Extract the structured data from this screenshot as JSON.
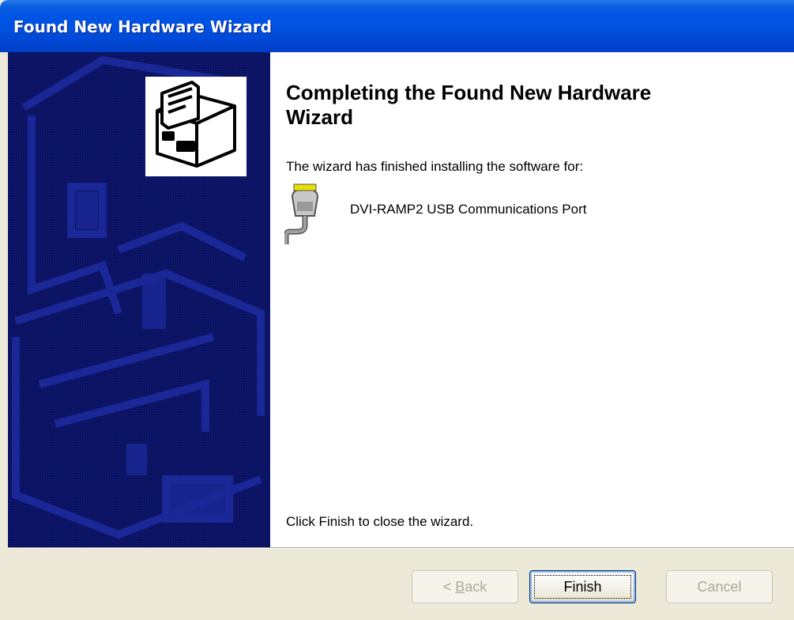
{
  "window": {
    "title": "Found New Hardware Wizard"
  },
  "wizard": {
    "heading": "Completing the Found New Hardware Wizard",
    "intro": "The wizard has finished installing the software for:",
    "device_name": "DVI-RAMP2 USB Communications Port",
    "device_icon": "serial-port-icon",
    "wizard_icon": "hardware-wizard-icon",
    "footer": "Click Finish to close the wizard."
  },
  "buttons": {
    "back": {
      "label_pre": "< ",
      "label_accel": "B",
      "label_post": "ack",
      "enabled": false
    },
    "finish": {
      "label": "Finish",
      "enabled": true
    },
    "cancel": {
      "label": "Cancel",
      "enabled": false
    }
  },
  "colors": {
    "titlebar": "#0054e3",
    "side_panel": "#0a1058",
    "dialog_bg": "#ece9d8"
  }
}
